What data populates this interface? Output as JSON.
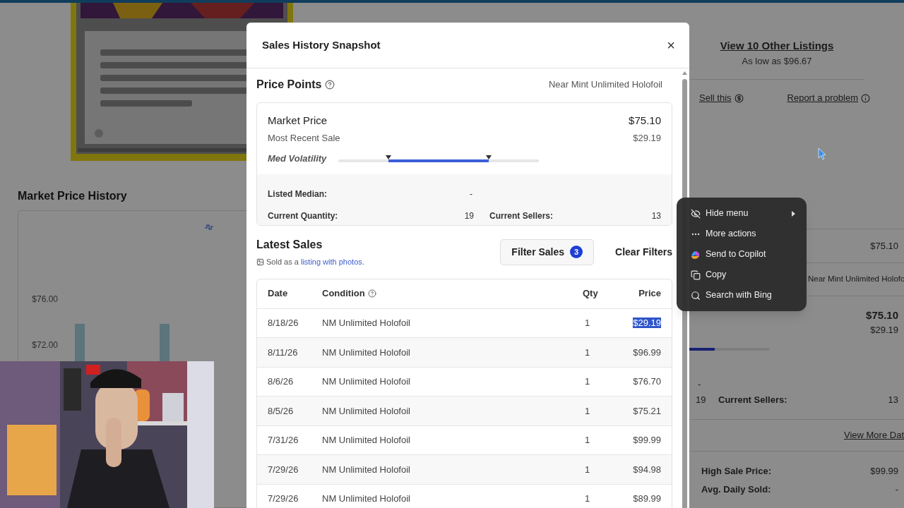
{
  "page": {
    "market_price_history": {
      "title": "Market Price History",
      "y_labels": [
        "$76.00",
        "$72.00"
      ]
    },
    "listings": {
      "link": "View 10 Other Listings",
      "low_price": "As low as $96.67"
    },
    "actions": [
      {
        "label": "Sell this",
        "kind": "dollar"
      },
      {
        "label": "Report a problem",
        "kind": "info"
      }
    ],
    "summary": {
      "row_value": "$75.10",
      "condition": "Near Mint Unlimited Holofo",
      "market_price": "$75.10",
      "recent_sale": "$29.19",
      "volatility": {
        "level": 0.32
      },
      "listed_median": "-",
      "current_quantity": "19",
      "current_sellers_label": "Current Sellers:",
      "current_sellers": "13",
      "view_more": "View More Dat",
      "high_sale_label": "High Sale Price:",
      "high_sale": "$99.99",
      "avg_daily_label": "Avg. Daily Sold:",
      "avg_daily": "-"
    }
  },
  "modal": {
    "title": "Sales History Snapshot",
    "close": "×",
    "price_points": {
      "title": "Price Points",
      "condition": "Near Mint Unlimited Holofoil",
      "market_price_label": "Market Price",
      "market_price": "$75.10",
      "recent_sale_label": "Most Recent Sale",
      "recent_sale": "$29.19",
      "volatility": {
        "label": "Med Volatility",
        "low_marker": {
          "level": 0.25
        },
        "high_marker": {
          "level": 0.75
        }
      },
      "listed_median_label": "Listed Median:",
      "listed_median": "-",
      "current_quantity_label": "Current Quantity:",
      "current_quantity": "19",
      "current_sellers_label": "Current Sellers:",
      "current_sellers": "13"
    },
    "latest_sales": {
      "title": "Latest Sales",
      "note_before": "Sold as a",
      "note_link": "listing with photos.",
      "filter_button": "Filter Sales",
      "filter_count": "3",
      "clear_button": "Clear Filters",
      "columns": [
        "Date",
        "Condition",
        "Qty",
        "Price"
      ],
      "rows": [
        {
          "date": "8/18/26",
          "condition": "NM Unlimited Holofoil",
          "qty": "1",
          "price": "$29.19",
          "highlighted": true
        },
        {
          "date": "8/11/26",
          "condition": "NM Unlimited Holofoil",
          "qty": "1",
          "price": "$96.99",
          "highlighted": false
        },
        {
          "date": "8/6/26",
          "condition": "NM Unlimited Holofoil",
          "qty": "1",
          "price": "$76.70",
          "highlighted": false
        },
        {
          "date": "8/5/26",
          "condition": "NM Unlimited Holofoil",
          "qty": "1",
          "price": "$75.21",
          "highlighted": false
        },
        {
          "date": "7/31/26",
          "condition": "NM Unlimited Holofoil",
          "qty": "1",
          "price": "$99.99",
          "highlighted": false
        },
        {
          "date": "7/29/26",
          "condition": "NM Unlimited Holofoil",
          "qty": "1",
          "price": "$94.98",
          "highlighted": false
        },
        {
          "date": "7/29/26",
          "condition": "NM Unlimited Holofoil",
          "qty": "1",
          "price": "$89.99",
          "highlighted": false
        }
      ]
    }
  },
  "context_menu": {
    "items": [
      {
        "label": "Hide menu",
        "kind": "hide",
        "submenu": true
      },
      {
        "label": "More actions",
        "kind": "more",
        "submenu": false
      },
      {
        "label": "Send to Copilot",
        "kind": "copilot",
        "submenu": false
      },
      {
        "label": "Copy",
        "kind": "copy",
        "submenu": false
      },
      {
        "label": "Search with Bing",
        "kind": "search",
        "submenu": false
      }
    ]
  }
}
